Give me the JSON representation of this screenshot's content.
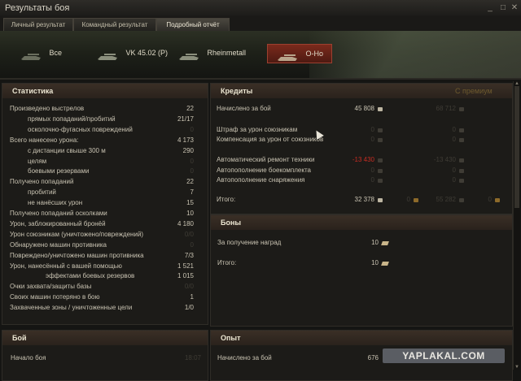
{
  "window": {
    "title": "Результаты боя"
  },
  "tabs": [
    {
      "label": "Личный результат"
    },
    {
      "label": "Командный результат"
    },
    {
      "label": "Подробный отчёт"
    }
  ],
  "vehicles": [
    {
      "label": "Все"
    },
    {
      "label": "VK 45.02 (P)"
    },
    {
      "label": "Rheinmetall"
    },
    {
      "label": "O-Ho"
    }
  ],
  "stats": {
    "title": "Статистика",
    "rows": [
      {
        "label": "Произведено выстрелов",
        "value": "22"
      },
      {
        "label": "прямых попаданий/пробитий",
        "value": "21/17"
      },
      {
        "label": "осколочно-фугасных повреждений",
        "value": "0"
      },
      {
        "label": "Всего нанесено урона:",
        "value": "4 173"
      },
      {
        "label": "с дистанции свыше 300 м",
        "value": "290"
      },
      {
        "label": "целям",
        "value": "0"
      },
      {
        "label": "боевыми резервами",
        "value": "0"
      },
      {
        "label": "Получено попаданий",
        "value": "22"
      },
      {
        "label": "пробитий",
        "value": "7"
      },
      {
        "label": "не нанёсших урон",
        "value": "15"
      },
      {
        "label": "Получено попаданий осколками",
        "value": "10"
      },
      {
        "label": "Урон, заблокированный бронёй",
        "value": "4 180"
      },
      {
        "label": "Урон союзникам (уничтожено/повреждений)",
        "value": "0/0"
      },
      {
        "label": "Обнаружено машин противника",
        "value": "0"
      },
      {
        "label": "Повреждено/уничтожено машин противника",
        "value": "7/3"
      },
      {
        "label": "Урон, нанесённый с вашей помощью",
        "value": "1 521"
      },
      {
        "label": "эффектами боевых резервов",
        "value": "1 015"
      },
      {
        "label": "Очки захвата/защиты базы",
        "value": "0/0"
      },
      {
        "label": "Своих машин потеряно в бою",
        "value": "1"
      },
      {
        "label": "Захваченные зоны / уничтоженные цели",
        "value": "1/0"
      }
    ]
  },
  "battle": {
    "title": "Бой",
    "rows": [
      {
        "label": "Начало боя",
        "value": "18:07"
      }
    ]
  },
  "credits": {
    "title": "Кредиты",
    "premium_header": "С премиум",
    "rows": [
      {
        "label": "Начислено за бой",
        "value": "45 808",
        "premium": "68 712"
      },
      {
        "label": "Штраф за урон союзникам",
        "value": "0",
        "premium": "0"
      },
      {
        "label": "Компенсация за урон от союзников",
        "value": "0",
        "premium": "0"
      },
      {
        "label": "Автоматический ремонт техники",
        "value": "-13 430",
        "premium": "-13 430"
      },
      {
        "label": "Автопополнение боекомплекта",
        "value": "0",
        "premium": "0"
      },
      {
        "label": "Автопополнение снаряжения",
        "value": "0",
        "premium": "0"
      }
    ],
    "total": {
      "label": "Итого:",
      "value": "32 378",
      "gold": "0",
      "premium": "55 282",
      "premium_gold": "0"
    }
  },
  "bonds": {
    "title": "Боны",
    "rows": [
      {
        "label": "За получение наград",
        "value": "10"
      },
      {
        "label": "Итого:",
        "value": "10"
      }
    ]
  },
  "experience": {
    "title": "Опыт",
    "rows": [
      {
        "label": "Начислено за бой",
        "value": "676"
      }
    ]
  },
  "watermark": "YAPLAKAL.COM"
}
